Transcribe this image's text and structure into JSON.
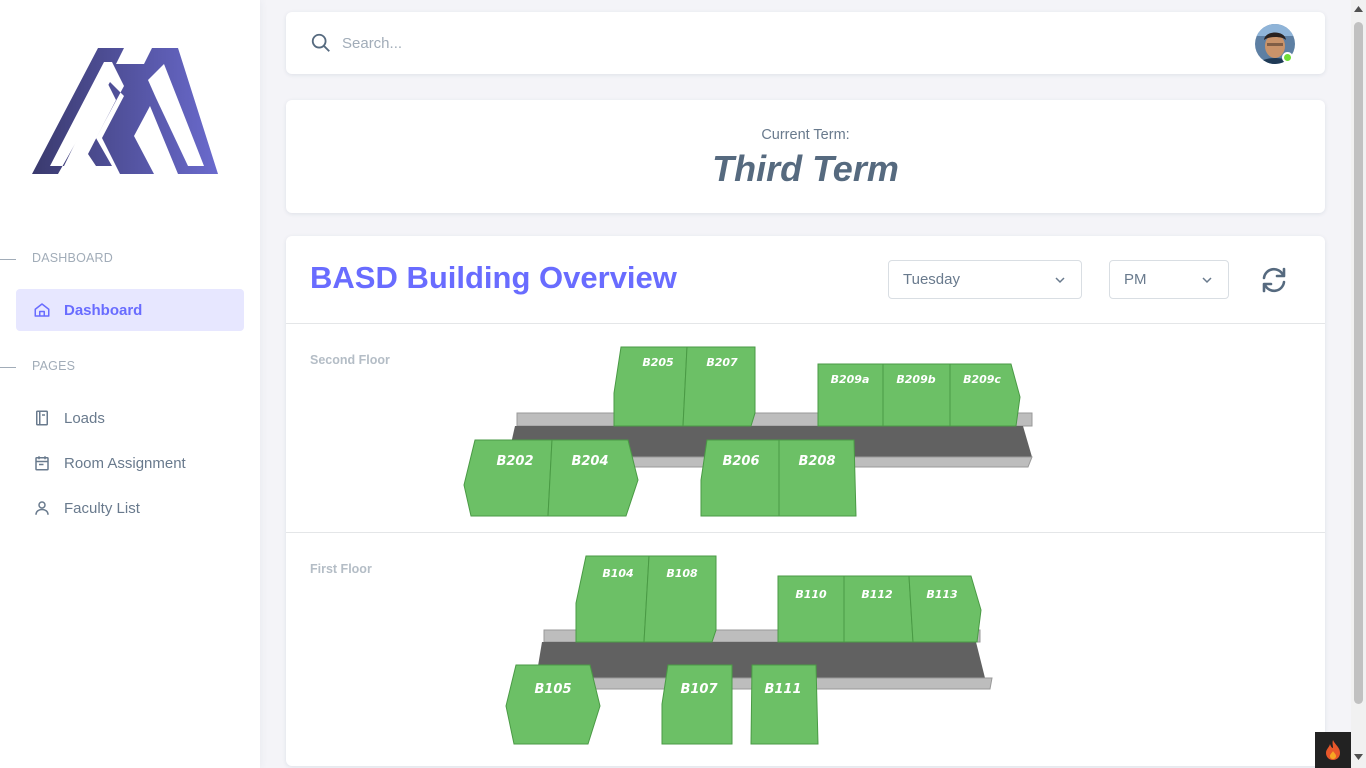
{
  "sidebar": {
    "headers": {
      "dashboard": "DASHBOARD",
      "pages": "PAGES"
    },
    "items": [
      {
        "label": "Dashboard",
        "icon": "home-icon",
        "active": true
      },
      {
        "label": "Loads",
        "icon": "book-icon",
        "active": false
      },
      {
        "label": "Room Assignment",
        "icon": "calendar-icon",
        "active": false
      },
      {
        "label": "Faculty List",
        "icon": "user-icon",
        "active": false
      }
    ]
  },
  "navbar": {
    "search_placeholder": "Search...",
    "search_value": "",
    "status_color": "#71dd37"
  },
  "term": {
    "label": "Current Term:",
    "value": "Third Term"
  },
  "overview": {
    "title": "BASD Building Overview",
    "day_select": "Tuesday",
    "period_select": "PM",
    "refresh_icon": "refresh-icon",
    "room_color": "#6cc066",
    "floors": [
      {
        "label": "Second Floor",
        "rooms_back": [
          "B205",
          "B207",
          "B209a",
          "B209b",
          "B209c"
        ],
        "rooms_front": [
          "B202",
          "B204",
          "B206",
          "B208"
        ]
      },
      {
        "label": "First Floor",
        "rooms_back": [
          "B104",
          "B108",
          "B110",
          "B112",
          "B113"
        ],
        "rooms_front": [
          "B105",
          "B107",
          "B111"
        ]
      }
    ]
  },
  "colors": {
    "accent": "#696cff",
    "active_bg": "#e7e7ff",
    "corridor": "#616161",
    "walkway": "#bdbdbd"
  }
}
